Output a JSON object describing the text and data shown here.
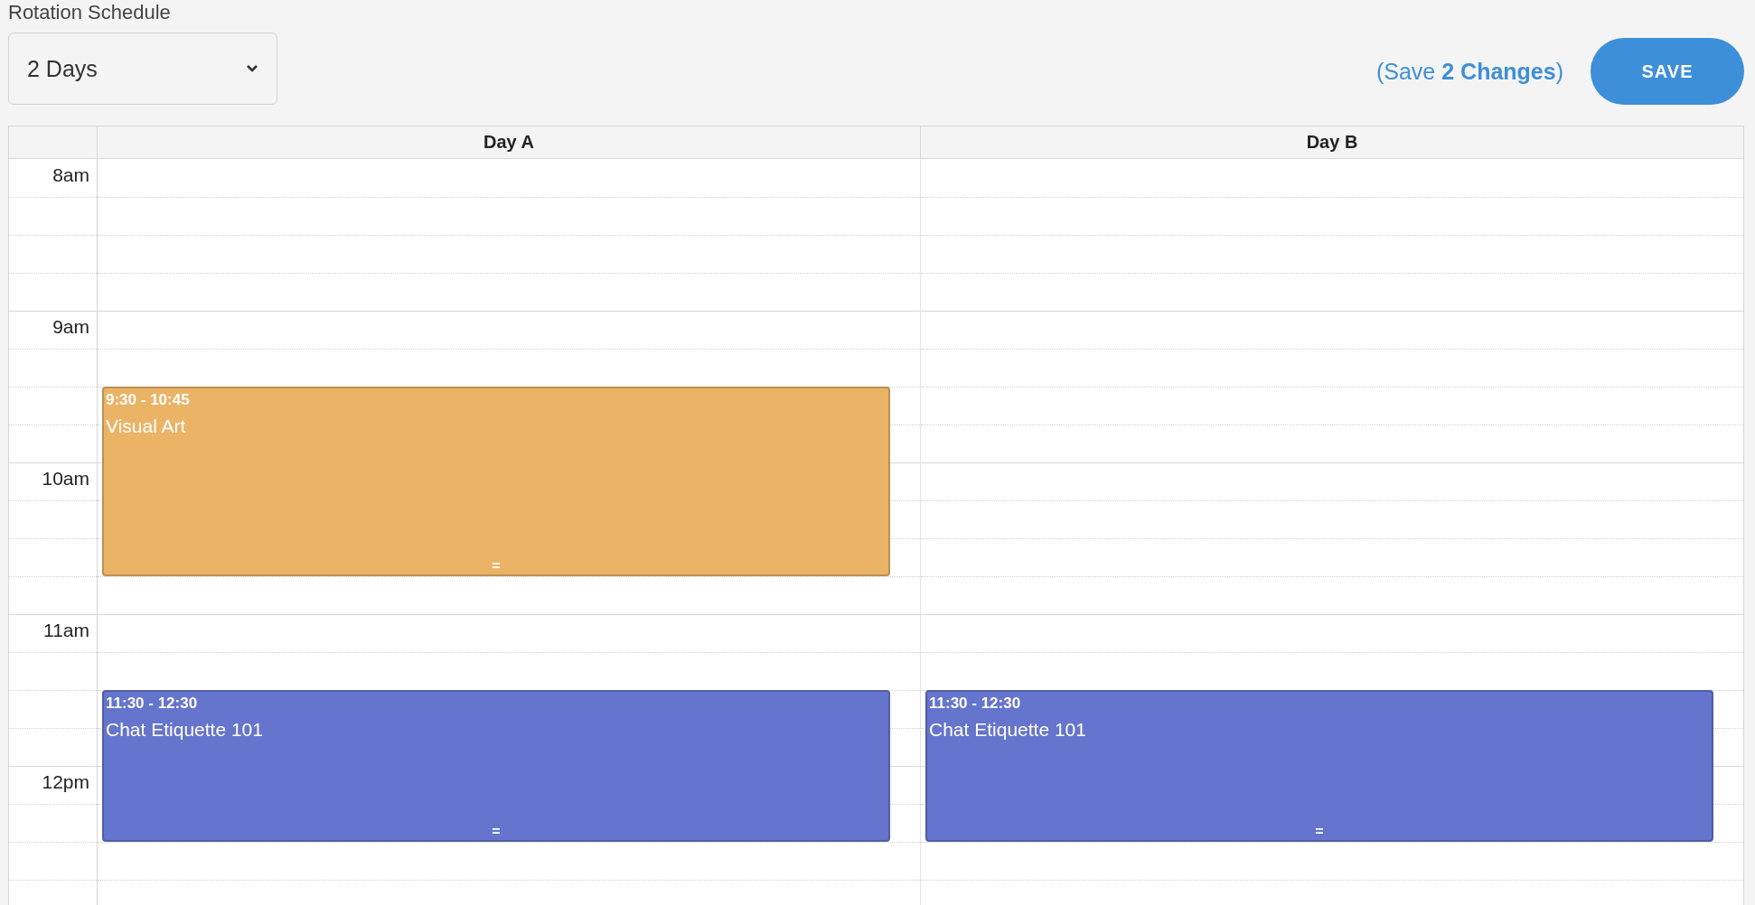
{
  "title": "Rotation Schedule",
  "rotation_select": {
    "value": "2 Days"
  },
  "save_changes_link": "(Save **2 Changes**)",
  "save_button": "SAVE",
  "hours": [
    "8am",
    "9am",
    "10am",
    "11am",
    "12pm"
  ],
  "days": [
    {
      "label": "Day A",
      "events": [
        {
          "time": "9:30 - 10:45",
          "title": "Visual Art",
          "handle": "=",
          "color": "#ebb366"
        },
        {
          "time": "11:30 - 12:30",
          "title": "Chat Etiquette 101",
          "handle": "=",
          "color": "#6574cc"
        }
      ]
    },
    {
      "label": "Day B",
      "events": [
        {
          "time": "11:30 - 12:30",
          "title": "Chat Etiquette 101",
          "handle": "=",
          "color": "#6574cc"
        }
      ]
    }
  ]
}
